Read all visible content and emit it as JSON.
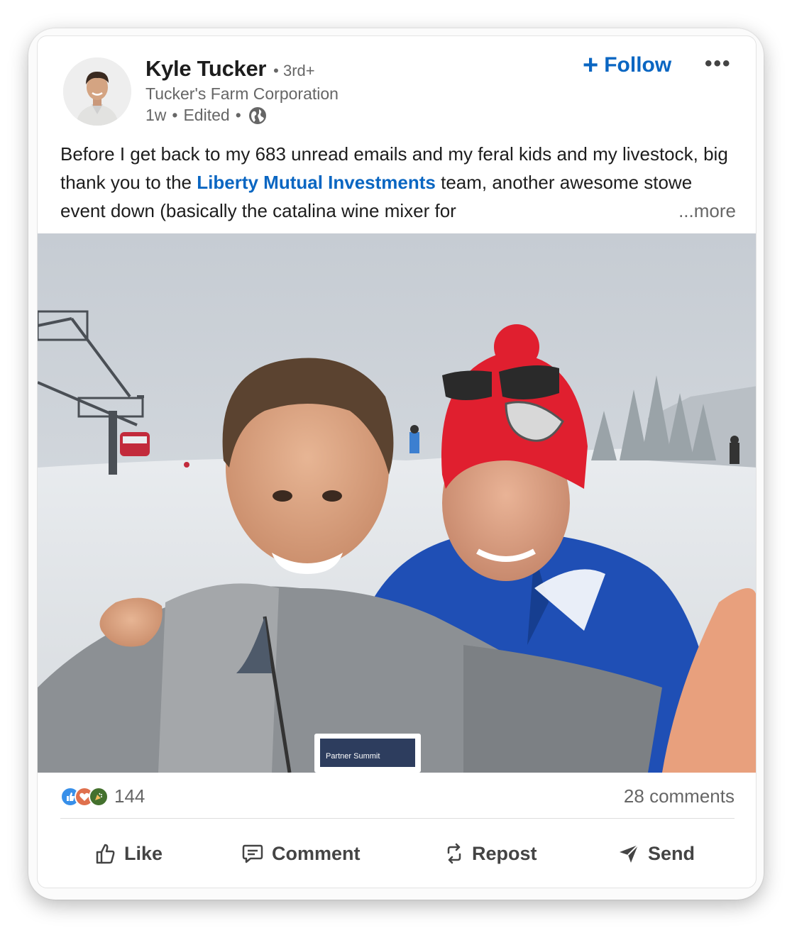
{
  "post": {
    "author": {
      "name": "Kyle Tucker",
      "degree": "• 3rd+",
      "company": "Tucker's Farm Corporation",
      "time": "1w",
      "edited": "Edited",
      "visibility_icon": "globe-icon"
    },
    "follow_label": "Follow",
    "more_icon": "•••",
    "text_before": "Before I get back to my 683 unread emails and my feral kids and my livestock, big thank you to the ",
    "text_link": "Liberty Mutual Investments",
    "text_after": " team, another awesome stowe event down (basically the catalina wine mixer for",
    "see_more": "...more",
    "badge": {
      "line1": "Partner Summit"
    },
    "reactions": {
      "icons": [
        "like-icon",
        "love-icon",
        "celebrate-icon"
      ],
      "count": "144",
      "comments": "28 comments"
    },
    "actions": {
      "like": "Like",
      "comment": "Comment",
      "repost": "Repost",
      "send": "Send"
    }
  },
  "colors": {
    "link": "#0a66c2",
    "text": "#1d1d1d",
    "muted": "#666666"
  }
}
